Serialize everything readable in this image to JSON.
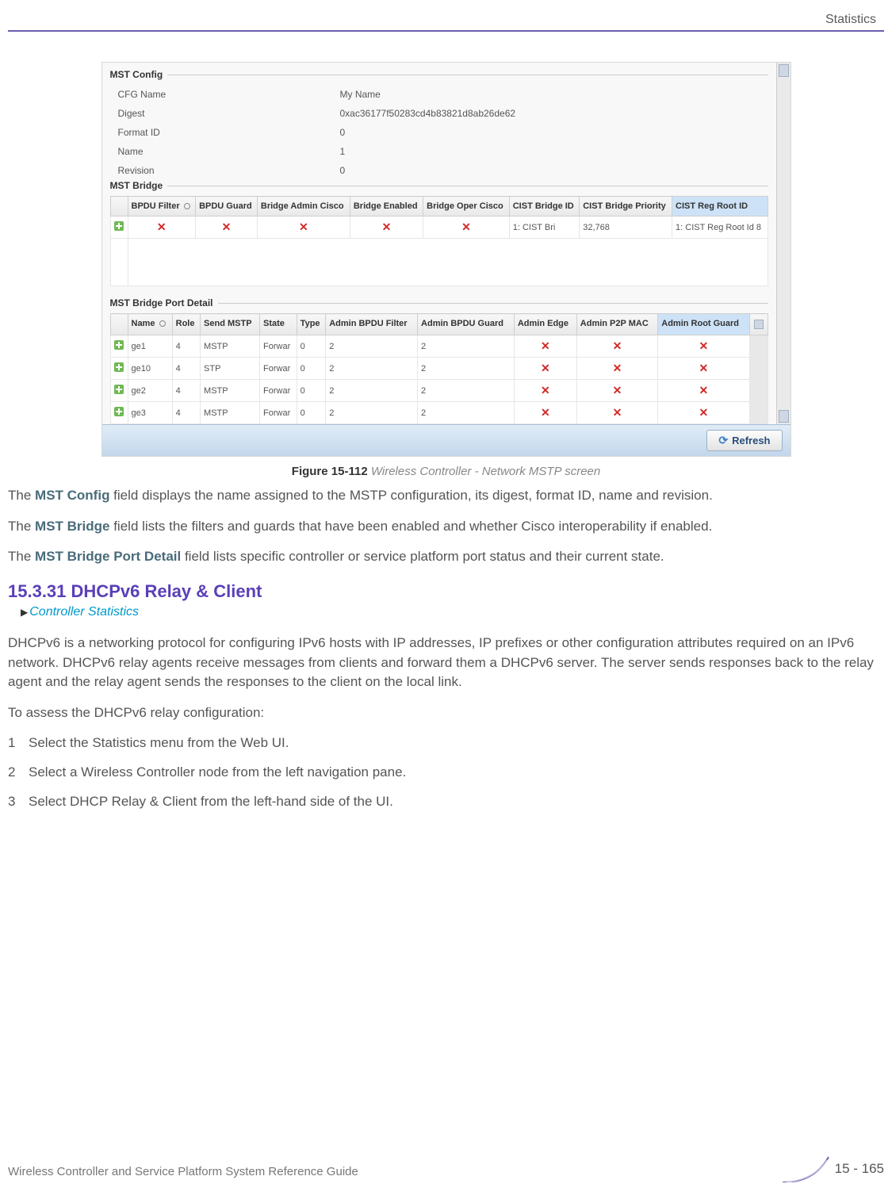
{
  "header": {
    "topright": "Statistics"
  },
  "screenshot": {
    "mst_config": {
      "legend": "MST Config",
      "rows": [
        {
          "k": "CFG Name",
          "v": "My Name"
        },
        {
          "k": "Digest",
          "v": "0xac36177f50283cd4b83821d8ab26de62"
        },
        {
          "k": "Format ID",
          "v": "0"
        },
        {
          "k": "Name",
          "v": "1"
        },
        {
          "k": "Revision",
          "v": "0"
        }
      ]
    },
    "mst_bridge": {
      "legend": "MST Bridge",
      "headers": [
        "",
        "BPDU Filter",
        "BPDU Guard",
        "Bridge Admin Cisco",
        "Bridge Enabled",
        "Bridge Oper Cisco",
        "CIST Bridge ID",
        "CIST Bridge Priority",
        "CIST Reg Root ID"
      ],
      "highlight_col": 8,
      "row": {
        "crosses": [
          true,
          true,
          true,
          true,
          true
        ],
        "cist_bridge_id": "1: CIST Bri",
        "cist_bridge_priority": "32,768",
        "cist_reg_root_id": "1: CIST Reg Root Id 8"
      }
    },
    "mst_bridge_port_detail": {
      "legend": "MST Bridge Port Detail",
      "headers": [
        "",
        "Name",
        "Role",
        "Send MSTP",
        "State",
        "Type",
        "Admin BPDU Filter",
        "Admin BPDU Guard",
        "Admin Edge",
        "Admin P2P MAC",
        "Admin Root Guard"
      ],
      "highlight_col": 10,
      "rows": [
        {
          "name": "ge1",
          "role": "4",
          "send": "MSTP",
          "state": "Forwar",
          "type": "0",
          "f": "2",
          "g": "2"
        },
        {
          "name": "ge10",
          "role": "4",
          "send": "STP",
          "state": "Forwar",
          "type": "0",
          "f": "2",
          "g": "2"
        },
        {
          "name": "ge2",
          "role": "4",
          "send": "MSTP",
          "state": "Forwar",
          "type": "0",
          "f": "2",
          "g": "2"
        },
        {
          "name": "ge3",
          "role": "4",
          "send": "MSTP",
          "state": "Forwar",
          "type": "0",
          "f": "2",
          "g": "2"
        }
      ]
    },
    "refresh_label": "Refresh"
  },
  "caption": {
    "prefix": "Figure 15-112",
    "text": "Wireless Controller - Network MSTP screen"
  },
  "paragraphs": {
    "p1a": "The ",
    "p1b": "MST Config",
    "p1c": " field displays the name assigned to the MSTP configuration, its digest, format ID, name and revision.",
    "p2a": "The ",
    "p2b": "MST Bridge",
    "p2c": " field lists the filters and guards that have been enabled and whether Cisco interoperability if enabled.",
    "p3a": "The ",
    "p3b": "MST Bridge Port Detail",
    "p3c": " field lists specific controller or service platform port status and their current state."
  },
  "section": {
    "number": "15.3.31",
    "title": "DHCPv6 Relay & Client",
    "breadcrumb": "Controller Statistics",
    "intro": "DHCPv6 is a networking protocol for configuring IPv6 hosts with IP addresses, IP prefixes or other configuration attributes required on an IPv6 network. DHCPv6 relay agents receive messages from clients and forward them a DHCPv6 server. The server sends responses back to the relay agent and the relay agent sends the responses to the client on the local link.",
    "lead": "To assess the DHCPv6 relay configuration:",
    "steps": {
      "s1a": "Select the ",
      "s1b": "Statistics",
      "s1c": " menu from the Web UI.",
      "s2": "Select a Wireless Controller node from the left navigation pane.",
      "s3a": "Select ",
      "s3b": "DHCP Relay & Client",
      "s3c": " from the left-hand side of the UI."
    }
  },
  "footer": {
    "text": "Wireless Controller and Service Platform System Reference Guide",
    "pagenum": "15 - 165"
  }
}
